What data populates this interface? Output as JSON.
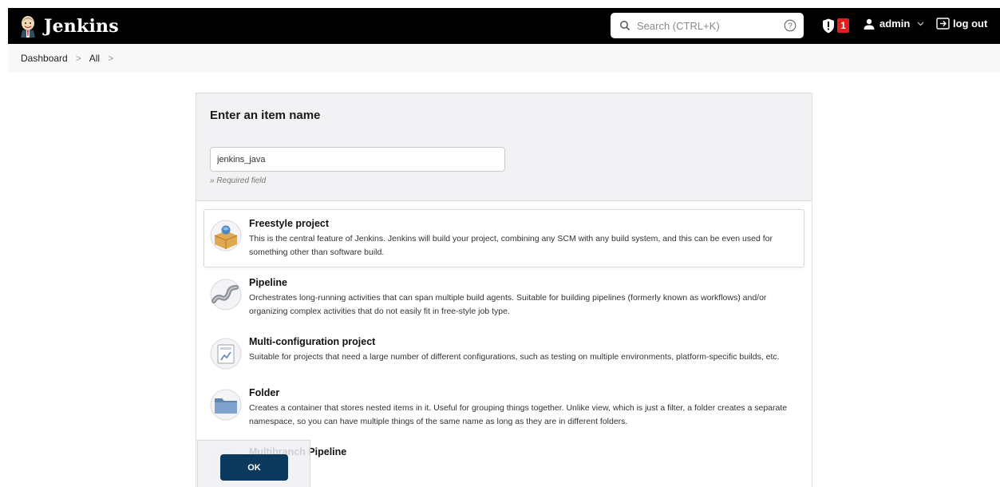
{
  "header": {
    "app_title": "Jenkins",
    "search_placeholder": "Search (CTRL+K)",
    "security_badge_count": "1",
    "user_name": "admin",
    "logout_label": "log out",
    "colors": {
      "bar": "#000000",
      "badge": "#e01e1e"
    }
  },
  "breadcrumb": {
    "items": [
      "Dashboard",
      "All"
    ]
  },
  "form": {
    "heading": "Enter an item name",
    "item_name_value": "jenkins_java",
    "required_note": "» Required field"
  },
  "item_types": [
    {
      "title": "Freestyle project",
      "description": "This is the central feature of Jenkins. Jenkins will build your project, combining any SCM with any build system, and this can be even used for something other than software build.",
      "icon": "freestyle-project-icon"
    },
    {
      "title": "Pipeline",
      "description": "Orchestrates long-running activities that can span multiple build agents. Suitable for building pipelines (formerly known as workflows) and/or organizing complex activities that do not easily fit in free-style job type.",
      "icon": "pipeline-icon"
    },
    {
      "title": "Multi-configuration project",
      "description": "Suitable for projects that need a large number of different configurations, such as testing on multiple environments, platform-specific builds, etc.",
      "icon": "multi-configuration-icon"
    },
    {
      "title": "Folder",
      "description": "Creates a container that stores nested items in it. Useful for grouping things together. Unlike view, which is just a filter, a folder creates a separate namespace, so you can have multiple things of the same name as long as they are in different folders.",
      "icon": "folder-icon"
    },
    {
      "title": "Multibranch Pipeline",
      "description": "",
      "icon": "multibranch-pipeline-icon"
    }
  ],
  "ok_label": "OK",
  "colors": {
    "ok_button": "#0b3a5e"
  }
}
